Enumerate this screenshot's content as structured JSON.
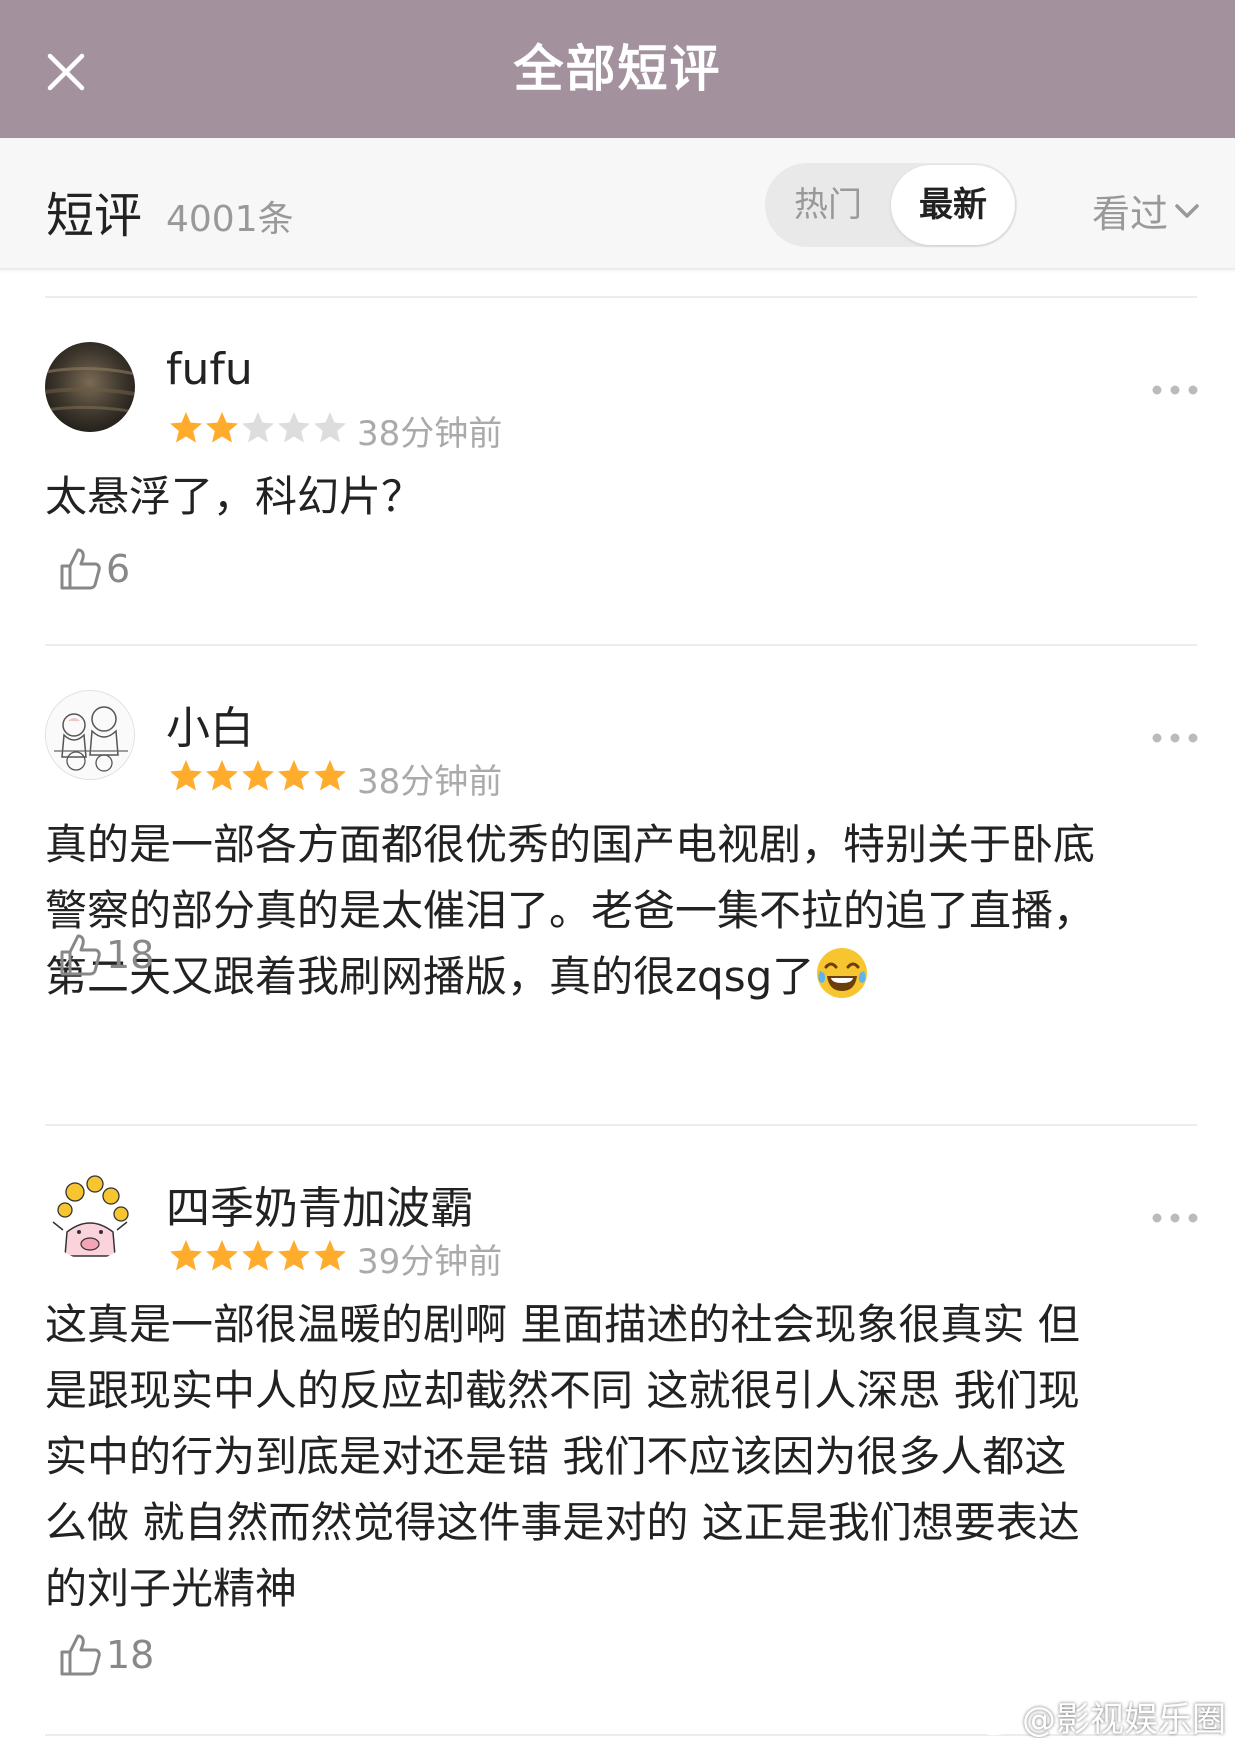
{
  "header": {
    "title": "全部短评",
    "close_icon": "close-icon"
  },
  "subheader": {
    "label": "短评",
    "count": "4001条",
    "tabs": [
      {
        "label": "热门",
        "selected": false
      },
      {
        "label": "最新",
        "selected": true
      }
    ],
    "filter_label": "看过"
  },
  "reviews": [
    {
      "username": "fufu",
      "rating": 2,
      "time": "38分钟前",
      "lines": [
        "太悬浮了，科幻片？"
      ],
      "likes": "6"
    },
    {
      "username": "小白",
      "rating": 5,
      "time": "38分钟前",
      "lines": [
        "真的是一部各方面都很优秀的国产电视剧，特别关于卧底",
        "警察的部分真的是太催泪了。老爸一集不拉的追了直播，",
        "第二天又跟着我刷网播版，真的很zqsg了"
      ],
      "likes": "18"
    },
    {
      "username": "四季奶青加波霸",
      "rating": 5,
      "time": "39分钟前",
      "lines": [
        "这真是一部很温暖的剧啊 里面描述的社会现象很真实 但",
        "是跟现实中人的反应却截然不同 这就很引人深思 我们现",
        "实中的行为到底是对还是错 我们不应该因为很多人都这",
        "么做 就自然而然觉得这件事是对的 这正是我们想要表达",
        "的刘子光精神"
      ],
      "likes": "18"
    }
  ],
  "watermark": "@影视娱乐圈",
  "colors": {
    "header_bg": "#a3929e",
    "star_on": "#ffac2d",
    "star_off": "#dddddd"
  }
}
